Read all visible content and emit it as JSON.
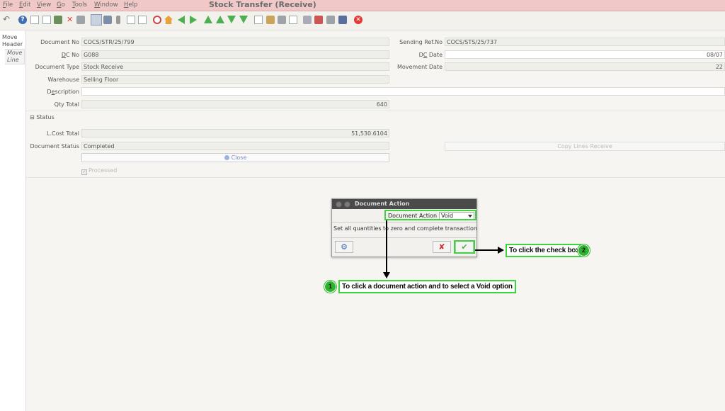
{
  "menu": {
    "file": "File",
    "edit": "Edit",
    "view": "View",
    "go": "Go",
    "tools": "Tools",
    "window": "Window",
    "help": "Help"
  },
  "window_title": "Stock Transfer (Receive)",
  "nav": {
    "move_header": "Move Header",
    "move_line": "Move Line"
  },
  "form": {
    "document_no": {
      "label": "Document No",
      "value": "COCS/STR/25/799"
    },
    "dc_no": {
      "label": "DC No",
      "value": "G088"
    },
    "document_type": {
      "label": "Document Type",
      "value": "Stock Receive"
    },
    "warehouse": {
      "label": "Warehouse",
      "value": "Selling Floor"
    },
    "description": {
      "label": "Description",
      "value": ""
    },
    "qty_total": {
      "label": "Qty Total",
      "value": "640"
    },
    "sending_ref_no": {
      "label": "Sending Ref.No",
      "value": "COCS/STS/25/737"
    },
    "dc_date": {
      "label": "DC Date",
      "value": "08/07"
    },
    "movement_date": {
      "label": "Movement Date",
      "value": "22"
    },
    "status_section": "Status",
    "l_cost_total": {
      "label": "L.Cost Total",
      "value": "51,530.6104"
    },
    "document_status": {
      "label": "Document Status",
      "value": "Completed"
    },
    "close_button": "Close",
    "copy_lines_button": "Copy Lines Receive",
    "processed": "Processed"
  },
  "dialog": {
    "title": "Document Action",
    "action_label": "Document Action",
    "action_value": "Void",
    "message": "Set all quantities to zero and complete transaction"
  },
  "annotations": {
    "step1_number": "1",
    "step1_text": "To click a document action and to select a Void option",
    "step2_number": "2",
    "step2_text": "To click the check box"
  },
  "colors": {
    "annotation_green": "#3fd23f",
    "title_bar": "#f0c8c8"
  }
}
